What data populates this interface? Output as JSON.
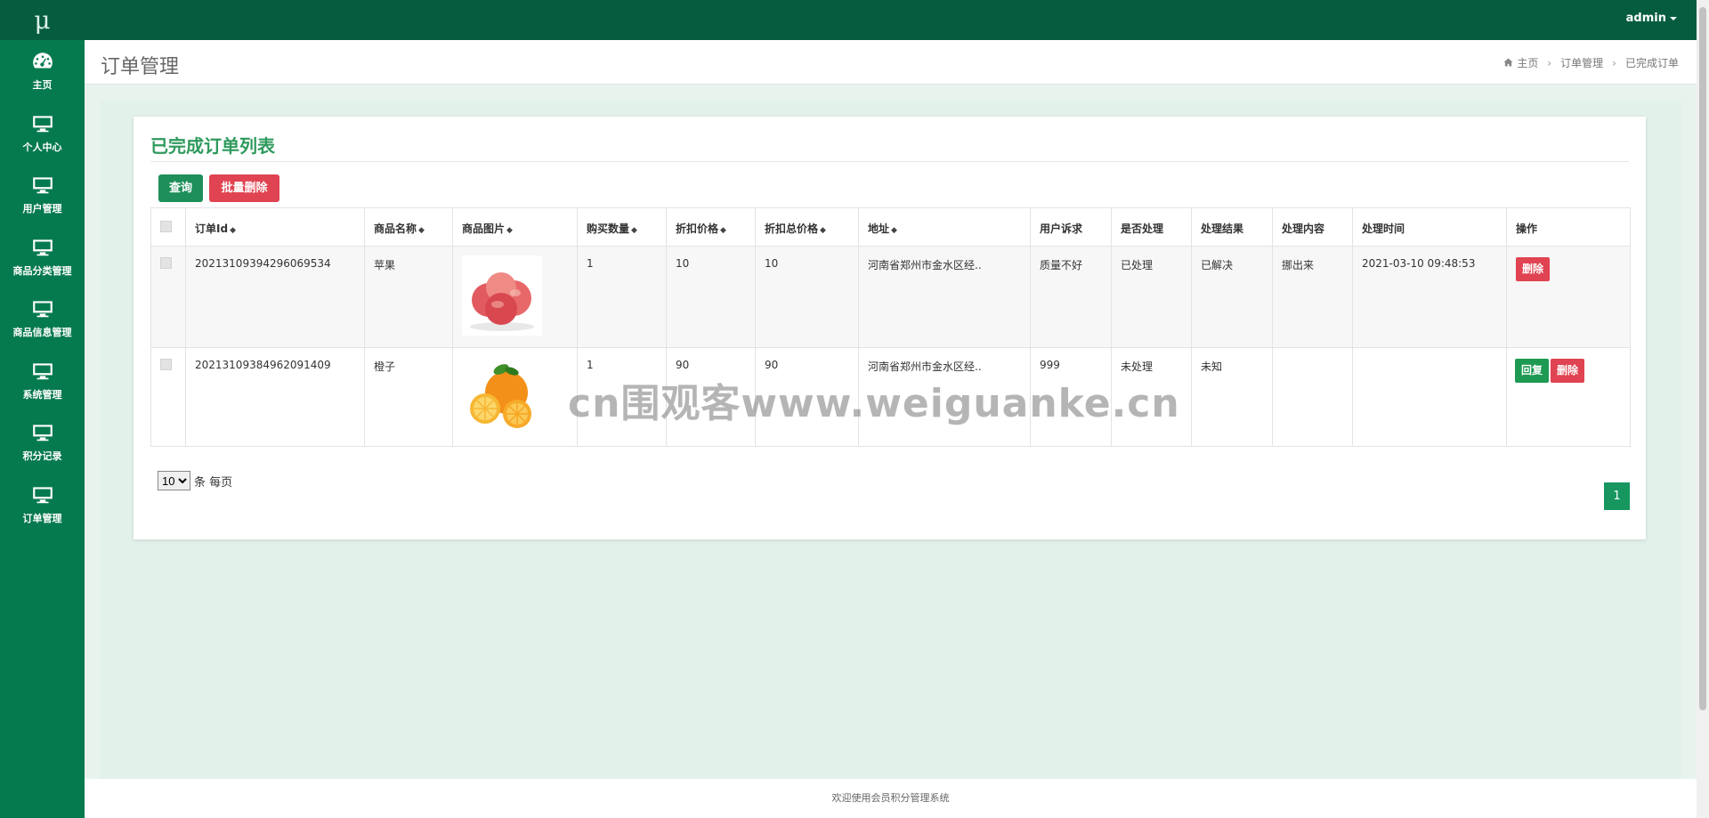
{
  "sidebar": {
    "logo": "μ",
    "items": [
      {
        "label": "主页",
        "icon": "dashboard-icon"
      },
      {
        "label": "个人中心",
        "icon": "monitor-icon"
      },
      {
        "label": "用户管理",
        "icon": "monitor-icon"
      },
      {
        "label": "商品分类管理",
        "icon": "monitor-icon"
      },
      {
        "label": "商品信息管理",
        "icon": "monitor-icon"
      },
      {
        "label": "系统管理",
        "icon": "monitor-icon"
      },
      {
        "label": "积分记录",
        "icon": "monitor-icon"
      },
      {
        "label": "订单管理",
        "icon": "monitor-icon"
      }
    ]
  },
  "topbar": {
    "user": "admin"
  },
  "page": {
    "title": "订单管理",
    "breadcrumb": [
      "主页",
      "订单管理",
      "已完成订单"
    ]
  },
  "panel": {
    "title": "已完成订单列表",
    "search_label": "查询",
    "bulk_delete_label": "批量删除"
  },
  "table": {
    "headers": [
      "订单Id",
      "商品名称",
      "商品图片",
      "购买数量",
      "折扣价格",
      "折扣总价格",
      "地址",
      "用户诉求",
      "是否处理",
      "处理结果",
      "处理内容",
      "处理时间",
      "操作"
    ],
    "rows": [
      {
        "order_id": "20213109394296069534",
        "name": "苹果",
        "image": "apple-image",
        "qty": "1",
        "price": "10",
        "total": "10",
        "address": "河南省郑州市金水区经..",
        "request": "质量不好",
        "handled": "已处理",
        "result": "已解决",
        "content": "挪出来",
        "time": "2021-03-10 09:48:53",
        "delete_label": "删除"
      },
      {
        "order_id": "20213109384962091409",
        "name": "橙子",
        "image": "orange-image",
        "qty": "1",
        "price": "90",
        "total": "90",
        "address": "河南省郑州市金水区经..",
        "request": "999",
        "handled": "未处理",
        "result": "未知",
        "content": "",
        "time": "",
        "reply_label": "回复",
        "delete_label": "删除"
      }
    ]
  },
  "pager": {
    "page_size": "10",
    "per_page_label": "条 每页",
    "current_page": "1"
  },
  "watermark": "cn围观客www.weiguanke.cn",
  "footer": "欢迎使用会员积分管理系统",
  "colors": {
    "sidebar": "#067a4f",
    "topbar": "#055c3f",
    "title_green": "#2f9a5d",
    "danger": "#e04351"
  }
}
